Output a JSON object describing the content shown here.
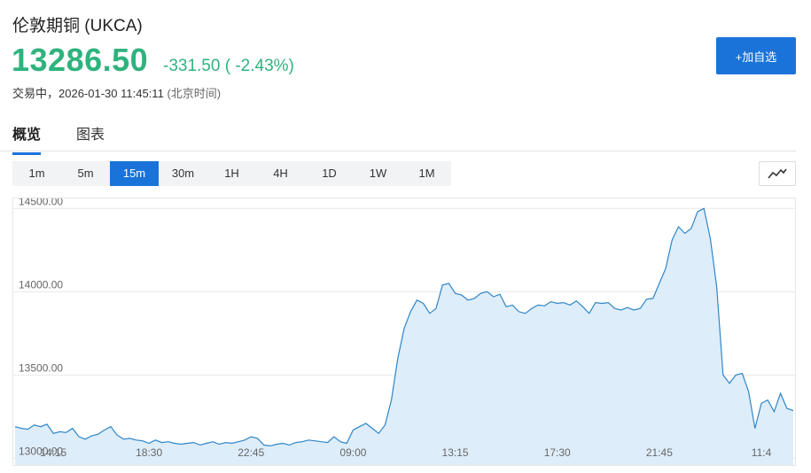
{
  "header": {
    "title": "伦敦期铜 (UKCA)",
    "price": "13286.50",
    "change": "-331.50 ( -2.43%)",
    "status_label": "交易中，",
    "timestamp": "2026-01-30 11:45:11",
    "timezone": "(北京时间)",
    "add_button": "+加自选"
  },
  "tabs": [
    {
      "label": "概览",
      "active": true
    },
    {
      "label": "图表",
      "active": false
    }
  ],
  "timeframes": [
    "1m",
    "5m",
    "15m",
    "30m",
    "1H",
    "4H",
    "1D",
    "1W",
    "1M"
  ],
  "active_timeframe": "15m",
  "colors": {
    "up_down": "#2fb37e",
    "accent": "#1a73d9",
    "line": "#2e86c9",
    "area": "#deedfa"
  },
  "chart_data": {
    "type": "area",
    "y_ticks": [
      "14500.00",
      "14000.00",
      "13500.00",
      "13000.00"
    ],
    "y_tick_values": [
      14500,
      14000,
      13500,
      13000
    ],
    "ylim": [
      12960,
      14560
    ],
    "x_ticks": [
      "14:15",
      "18:30",
      "22:45",
      "09:00",
      "13:15",
      "17:30",
      "21:45",
      "11:4"
    ],
    "x_tick_index": [
      6,
      21,
      37,
      53,
      69,
      85,
      101,
      117
    ],
    "grid": true,
    "values": [
      13190,
      13180,
      13175,
      13200,
      13190,
      13205,
      13150,
      13160,
      13155,
      13180,
      13130,
      13115,
      13135,
      13145,
      13170,
      13190,
      13140,
      13115,
      13120,
      13110,
      13105,
      13090,
      13110,
      13095,
      13100,
      13090,
      13085,
      13090,
      13095,
      13080,
      13090,
      13100,
      13085,
      13095,
      13090,
      13100,
      13110,
      13130,
      13120,
      13080,
      13075,
      13085,
      13090,
      13080,
      13095,
      13100,
      13110,
      13105,
      13100,
      13095,
      13130,
      13100,
      13090,
      13170,
      13190,
      13210,
      13180,
      13150,
      13200,
      13350,
      13600,
      13780,
      13880,
      13950,
      13930,
      13870,
      13900,
      14040,
      14050,
      13990,
      13980,
      13950,
      13960,
      13990,
      14000,
      13970,
      13985,
      13910,
      13920,
      13880,
      13870,
      13900,
      13920,
      13915,
      13940,
      13930,
      13935,
      13920,
      13945,
      13910,
      13870,
      13935,
      13930,
      13935,
      13900,
      13890,
      13905,
      13890,
      13900,
      13955,
      13960,
      14050,
      14140,
      14310,
      14390,
      14350,
      14380,
      14480,
      14500,
      14320,
      14030,
      13500,
      13450,
      13500,
      13510,
      13400,
      13180,
      13330,
      13350,
      13280,
      13390,
      13300,
      13286.5
    ]
  }
}
